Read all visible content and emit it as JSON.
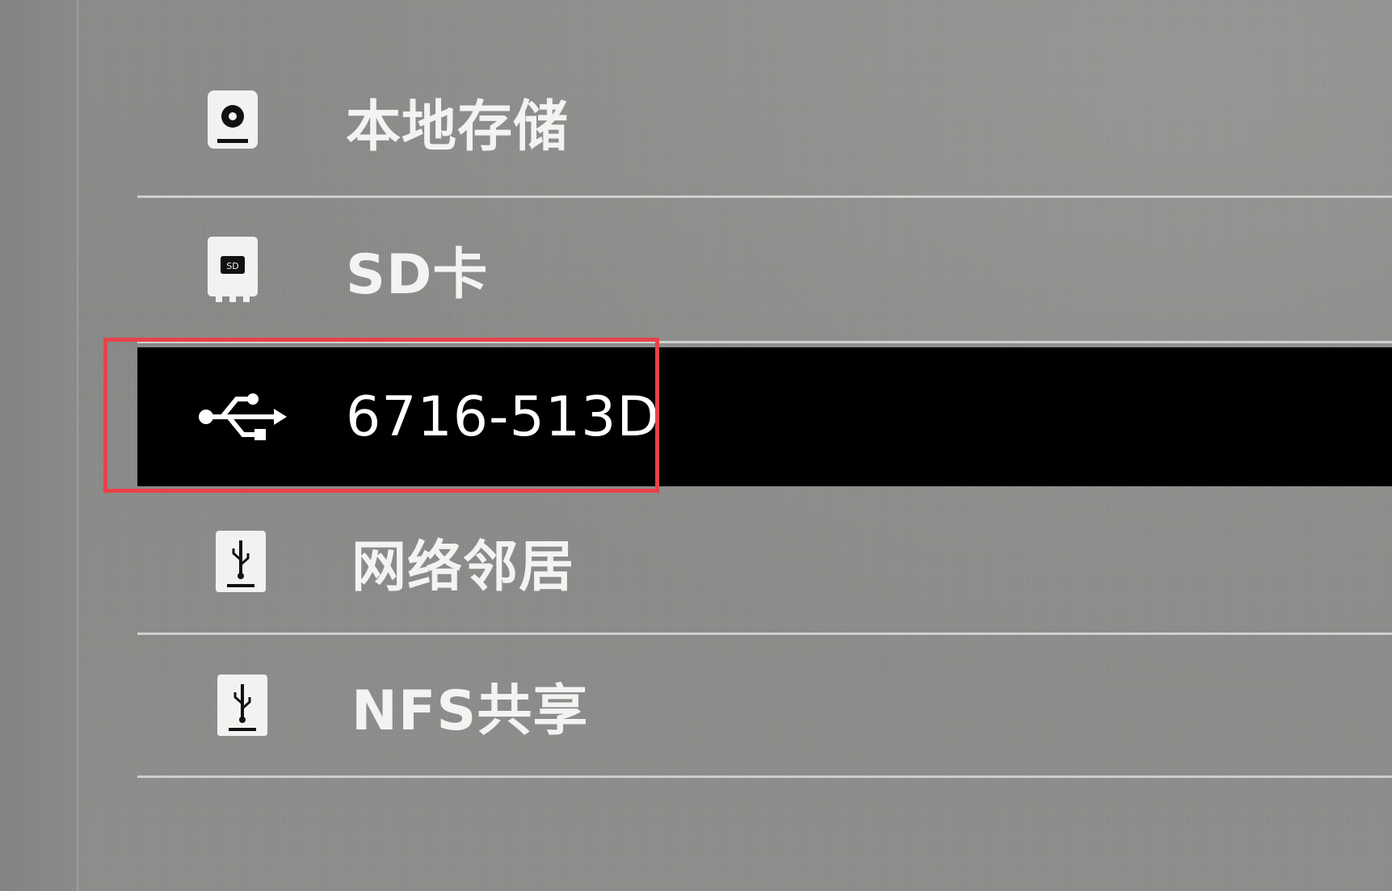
{
  "storage_list": {
    "items": [
      {
        "label": "本地存储",
        "icon": "disk-icon",
        "selected": false
      },
      {
        "label": "SD卡",
        "icon": "sd-card-icon",
        "selected": false
      },
      {
        "label": "6716-513D",
        "icon": "usb-icon",
        "selected": true
      },
      {
        "label": "网络邻居",
        "icon": "network-drive-icon",
        "selected": false
      },
      {
        "label": "NFS共享",
        "icon": "nfs-drive-icon",
        "selected": false
      }
    ]
  },
  "highlight": {
    "color": "#e8424a"
  },
  "colors": {
    "selected_background": "#000000",
    "text": "#f3f3f1",
    "background": "#8c8c8a"
  }
}
